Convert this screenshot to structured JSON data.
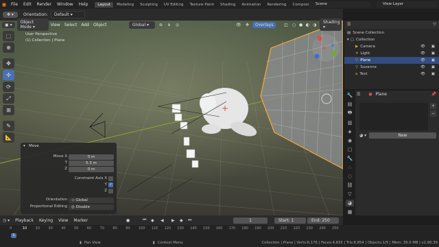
{
  "menus": [
    "File",
    "Edit",
    "Render",
    "Window",
    "Help"
  ],
  "workspaces": [
    {
      "label": "Layout",
      "active": true
    },
    {
      "label": "Modeling",
      "active": false
    },
    {
      "label": "Sculpting",
      "active": false
    },
    {
      "label": "UV Editing",
      "active": false
    },
    {
      "label": "Texture Paint",
      "active": false
    },
    {
      "label": "Shading",
      "active": false
    },
    {
      "label": "Animation",
      "active": false
    },
    {
      "label": "Rendering",
      "active": false
    },
    {
      "label": "Compositing",
      "active": false
    }
  ],
  "scene": {
    "label": "Scene"
  },
  "view_layer": {
    "label": "View Layer"
  },
  "header": {
    "orientation_label": "Orientation:",
    "orientation_value": "Default"
  },
  "transform": {
    "orientation": "Global"
  },
  "viewport_header": {
    "mode": "Object Mode",
    "menus": [
      "View",
      "Select",
      "Add",
      "Object"
    ],
    "overlays": "Overlays",
    "shading": "Shading"
  },
  "viewport_info": {
    "view": "User Perspective",
    "object": "(1) Collection | Plane"
  },
  "move_panel": {
    "title": "Move",
    "move_x_label": "Move X",
    "move_x": "0 m",
    "y_label": "Y",
    "move_y": "5.3 m",
    "z_label": "Z",
    "move_z": "0 m",
    "constraint_label": "Constraint Axis X",
    "constraint_y": "Y",
    "constraint_z": "Z",
    "orientation_label": "Orientation",
    "orientation_value": "Global",
    "prop_label": "Proportional Editing",
    "prop_value": "Disable"
  },
  "outliner": {
    "root": "Scene Collection",
    "collection": "Collection",
    "items": [
      {
        "label": "Camera",
        "selected": false
      },
      {
        "label": "Light",
        "selected": false
      },
      {
        "label": "Plane",
        "selected": true
      },
      {
        "label": "Suzanne",
        "selected": false
      },
      {
        "label": "Text",
        "selected": false
      }
    ]
  },
  "properties": {
    "object_name": "Plane",
    "new_button": "New"
  },
  "timeline": {
    "menus": [
      "Playback",
      "Keying",
      "View",
      "Marker"
    ],
    "current_frame": "1",
    "start_label": "Start:",
    "start": "1",
    "end_label": "End:",
    "end": "250",
    "ticks": [
      "0",
      "10",
      "20",
      "30",
      "40",
      "50",
      "60",
      "70",
      "80",
      "90",
      "100",
      "110",
      "120",
      "130",
      "140",
      "150",
      "160",
      "170",
      "180",
      "190",
      "200",
      "210",
      "220",
      "230",
      "240",
      "250"
    ]
  },
  "status": {
    "pan_view": "Pan View",
    "context_menu": "Context Menu",
    "stats": "Collection | Plane | Verts:6,176 | Faces:4,835 | Tris:8,854 | Objects:1/5 | Mem: 39.0 MB | v2.80.39"
  },
  "colors": {
    "accent": "#4772b3",
    "selected": "#334d80",
    "active_orange": "#ffaa33"
  }
}
